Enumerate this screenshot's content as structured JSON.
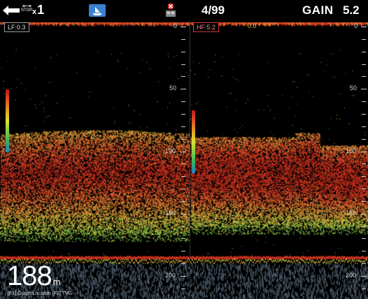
{
  "topbar": {
    "multiplier_prefix": "x",
    "multiplier": "1",
    "stop_label": "STOP",
    "page_counter": "4/99",
    "gain_label": "GAIN",
    "gain_value": "5.2"
  },
  "left_panel": {
    "freq_label": "LF:0.3",
    "scale": [
      "0",
      "50",
      "100",
      "150",
      "200"
    ]
  },
  "right_panel": {
    "freq_label": "HF:5.2",
    "scale": [
      "0",
      "50",
      "100",
      "150",
      "200"
    ],
    "cursor_value": "0.0"
  },
  "depth": {
    "value": "188",
    "unit": "m"
  },
  "help": "[F1] Graph Location   [F2] TVG",
  "colors": {
    "accent_red": "#cc3333",
    "seabed_red": "#c8301e",
    "fish_orange": "#e07030",
    "fish_yellow": "#d0c040",
    "fish_green": "#60b040"
  }
}
